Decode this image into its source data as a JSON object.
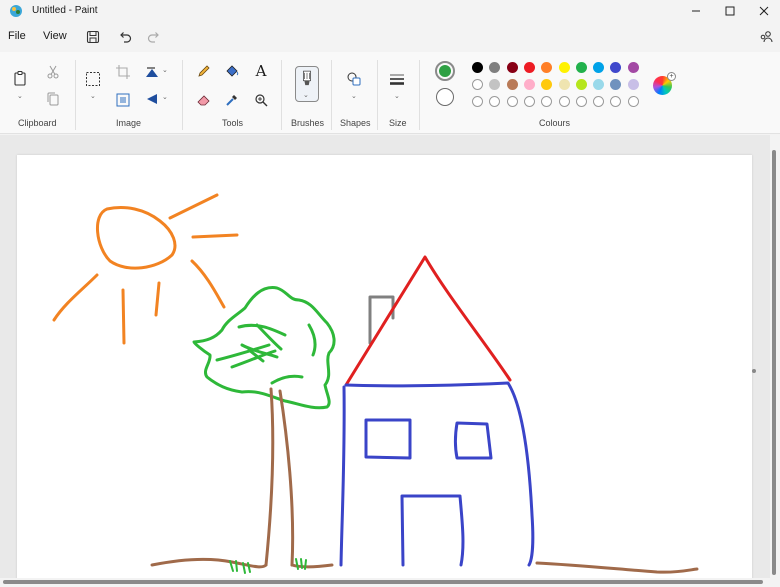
{
  "window": {
    "title": "Untitled - Paint",
    "controls": [
      "minimize",
      "maximize",
      "close"
    ]
  },
  "menu": {
    "file": "File",
    "view": "View"
  },
  "quick_access": [
    "save-icon",
    "undo-icon",
    "redo-icon"
  ],
  "ribbon": {
    "groups": {
      "clipboard": "Clipboard",
      "image": "Image",
      "tools": "Tools",
      "brushes": "Brushes",
      "shapes": "Shapes",
      "size": "Size",
      "colours": "Colours"
    },
    "tools": {
      "text_icon_glyph": "A"
    }
  },
  "colors": {
    "primary": "#2ea043",
    "secondary": "#ffffff",
    "palette_row1": [
      "#000000",
      "#7f7f7f",
      "#880015",
      "#ed1c24",
      "#ff7f27",
      "#fff200",
      "#22b14c",
      "#00a2e8",
      "#3f48cc",
      "#a349a4"
    ],
    "palette_row2": [
      "#ffffff",
      "#c3c3c3",
      "#b97a57",
      "#ffaec9",
      "#ffc90e",
      "#efe4b0",
      "#b5e61d",
      "#99d9ea",
      "#7092be",
      "#c8bfe7"
    ],
    "palette_row3_custom_slots": 10
  },
  "drawing": {
    "subject": "house-tree-sun",
    "stroke_colors": {
      "sun": "#f28322",
      "tree_foliage": "#2eb839",
      "trunk_ground": "#a06a4a",
      "roof": "#e02020",
      "house": "#3a44c8",
      "chimney": "#808080",
      "grass": "#2eb839"
    }
  }
}
